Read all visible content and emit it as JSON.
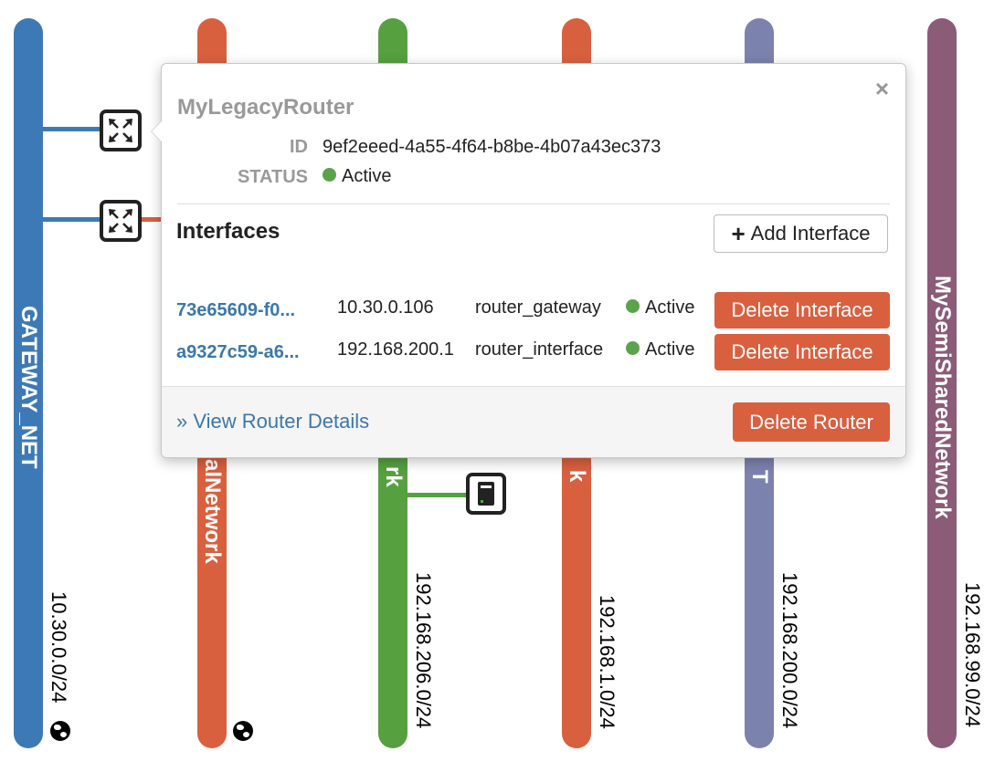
{
  "networks": [
    {
      "name": "GATEWAY_NET",
      "cidr": "10.30.0.0/24",
      "color": "#3d7ab5",
      "external": true
    },
    {
      "name": "alNetwork",
      "cidr": "",
      "color": "#d9603f",
      "external": true
    },
    {
      "name": "rk",
      "cidr": "192.168.206.0/24",
      "color": "#56a040",
      "external": false
    },
    {
      "name": "k",
      "cidr": "192.168.1.0/24",
      "color": "#d9603f",
      "external": false
    },
    {
      "name": "T",
      "cidr": "192.168.200.0/24",
      "color": "#7c82ae",
      "external": false
    },
    {
      "name": "MySemiSharedNetwork",
      "cidr": "192.168.99.0/24",
      "color": "#8b5b78",
      "external": false
    }
  ],
  "popup": {
    "title": "MyLegacyRouter",
    "id_label": "ID",
    "id_value": "9ef2eeed-4a55-4f64-b8be-4b07a43ec373",
    "status_label": "STATUS",
    "status_value": "Active",
    "interfaces_title": "Interfaces",
    "add_interface_label": "Add Interface",
    "close_symbol": "×",
    "interfaces": [
      {
        "id": "73e65609-f0...",
        "ip": "10.30.0.106",
        "name": "router_gateway",
        "status": "Active",
        "delete_label": "Delete Interface"
      },
      {
        "id": "a9327c59-a6...",
        "ip": "192.168.200.1",
        "name": "router_interface",
        "status": "Active",
        "delete_label": "Delete Interface"
      }
    ],
    "view_details_label": "» View Router Details",
    "delete_router_label": "Delete Router"
  },
  "colors": {
    "active_dot": "#5aa34a",
    "danger": "#d9603f",
    "link": "#3a78ab"
  },
  "icons": {
    "router": "router-arrows-icon",
    "instance": "server-instance-icon",
    "external": "globe-icon",
    "add": "plus-icon",
    "close": "close-icon"
  }
}
